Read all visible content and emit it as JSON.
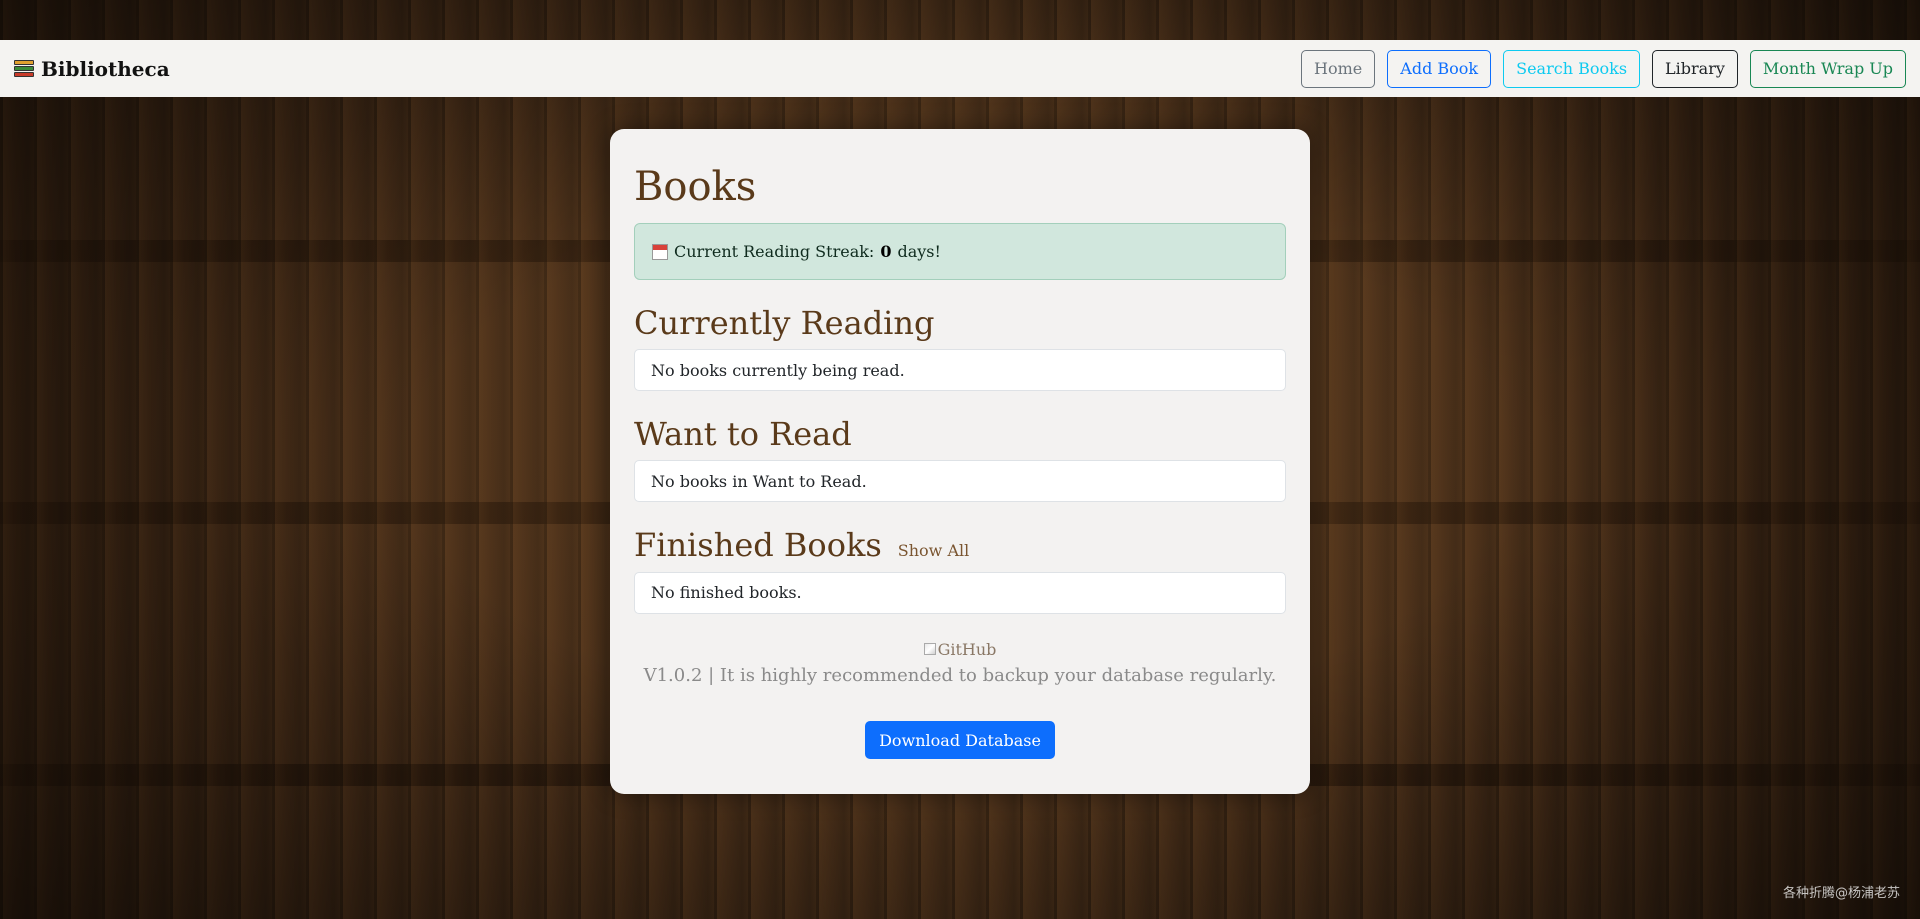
{
  "navbar": {
    "brand": "Bibliotheca",
    "buttons": {
      "home": "Home",
      "add_book": "Add Book",
      "search_books": "Search Books",
      "library": "Library",
      "month_wrap_up": "Month Wrap Up"
    }
  },
  "main": {
    "title": "Books",
    "streak": {
      "prefix": "Current Reading Streak:",
      "count": "0",
      "suffix": "days!"
    },
    "currently_reading": {
      "heading": "Currently Reading",
      "empty": "No books currently being read."
    },
    "want_to_read": {
      "heading": "Want to Read",
      "empty": "No books in Want to Read."
    },
    "finished": {
      "heading": "Finished Books",
      "show_all": "Show All",
      "empty": "No finished books."
    },
    "footer": {
      "github_alt": "GitHub",
      "version_text": "V1.0.2 | It is highly recommended to backup your database regularly.",
      "download_label": "Download Database"
    }
  },
  "watermark": "各种折腾@杨浦老苏",
  "colors": {
    "heading": "#5a3a1a",
    "streak_bg": "#d1e7dd",
    "primary": "#0d6efd",
    "secondary": "#6c757d",
    "info": "#0dcaf0",
    "dark": "#212529",
    "success": "#198754"
  },
  "icons": {
    "brand": "books-icon",
    "streak": "calendar-icon"
  }
}
